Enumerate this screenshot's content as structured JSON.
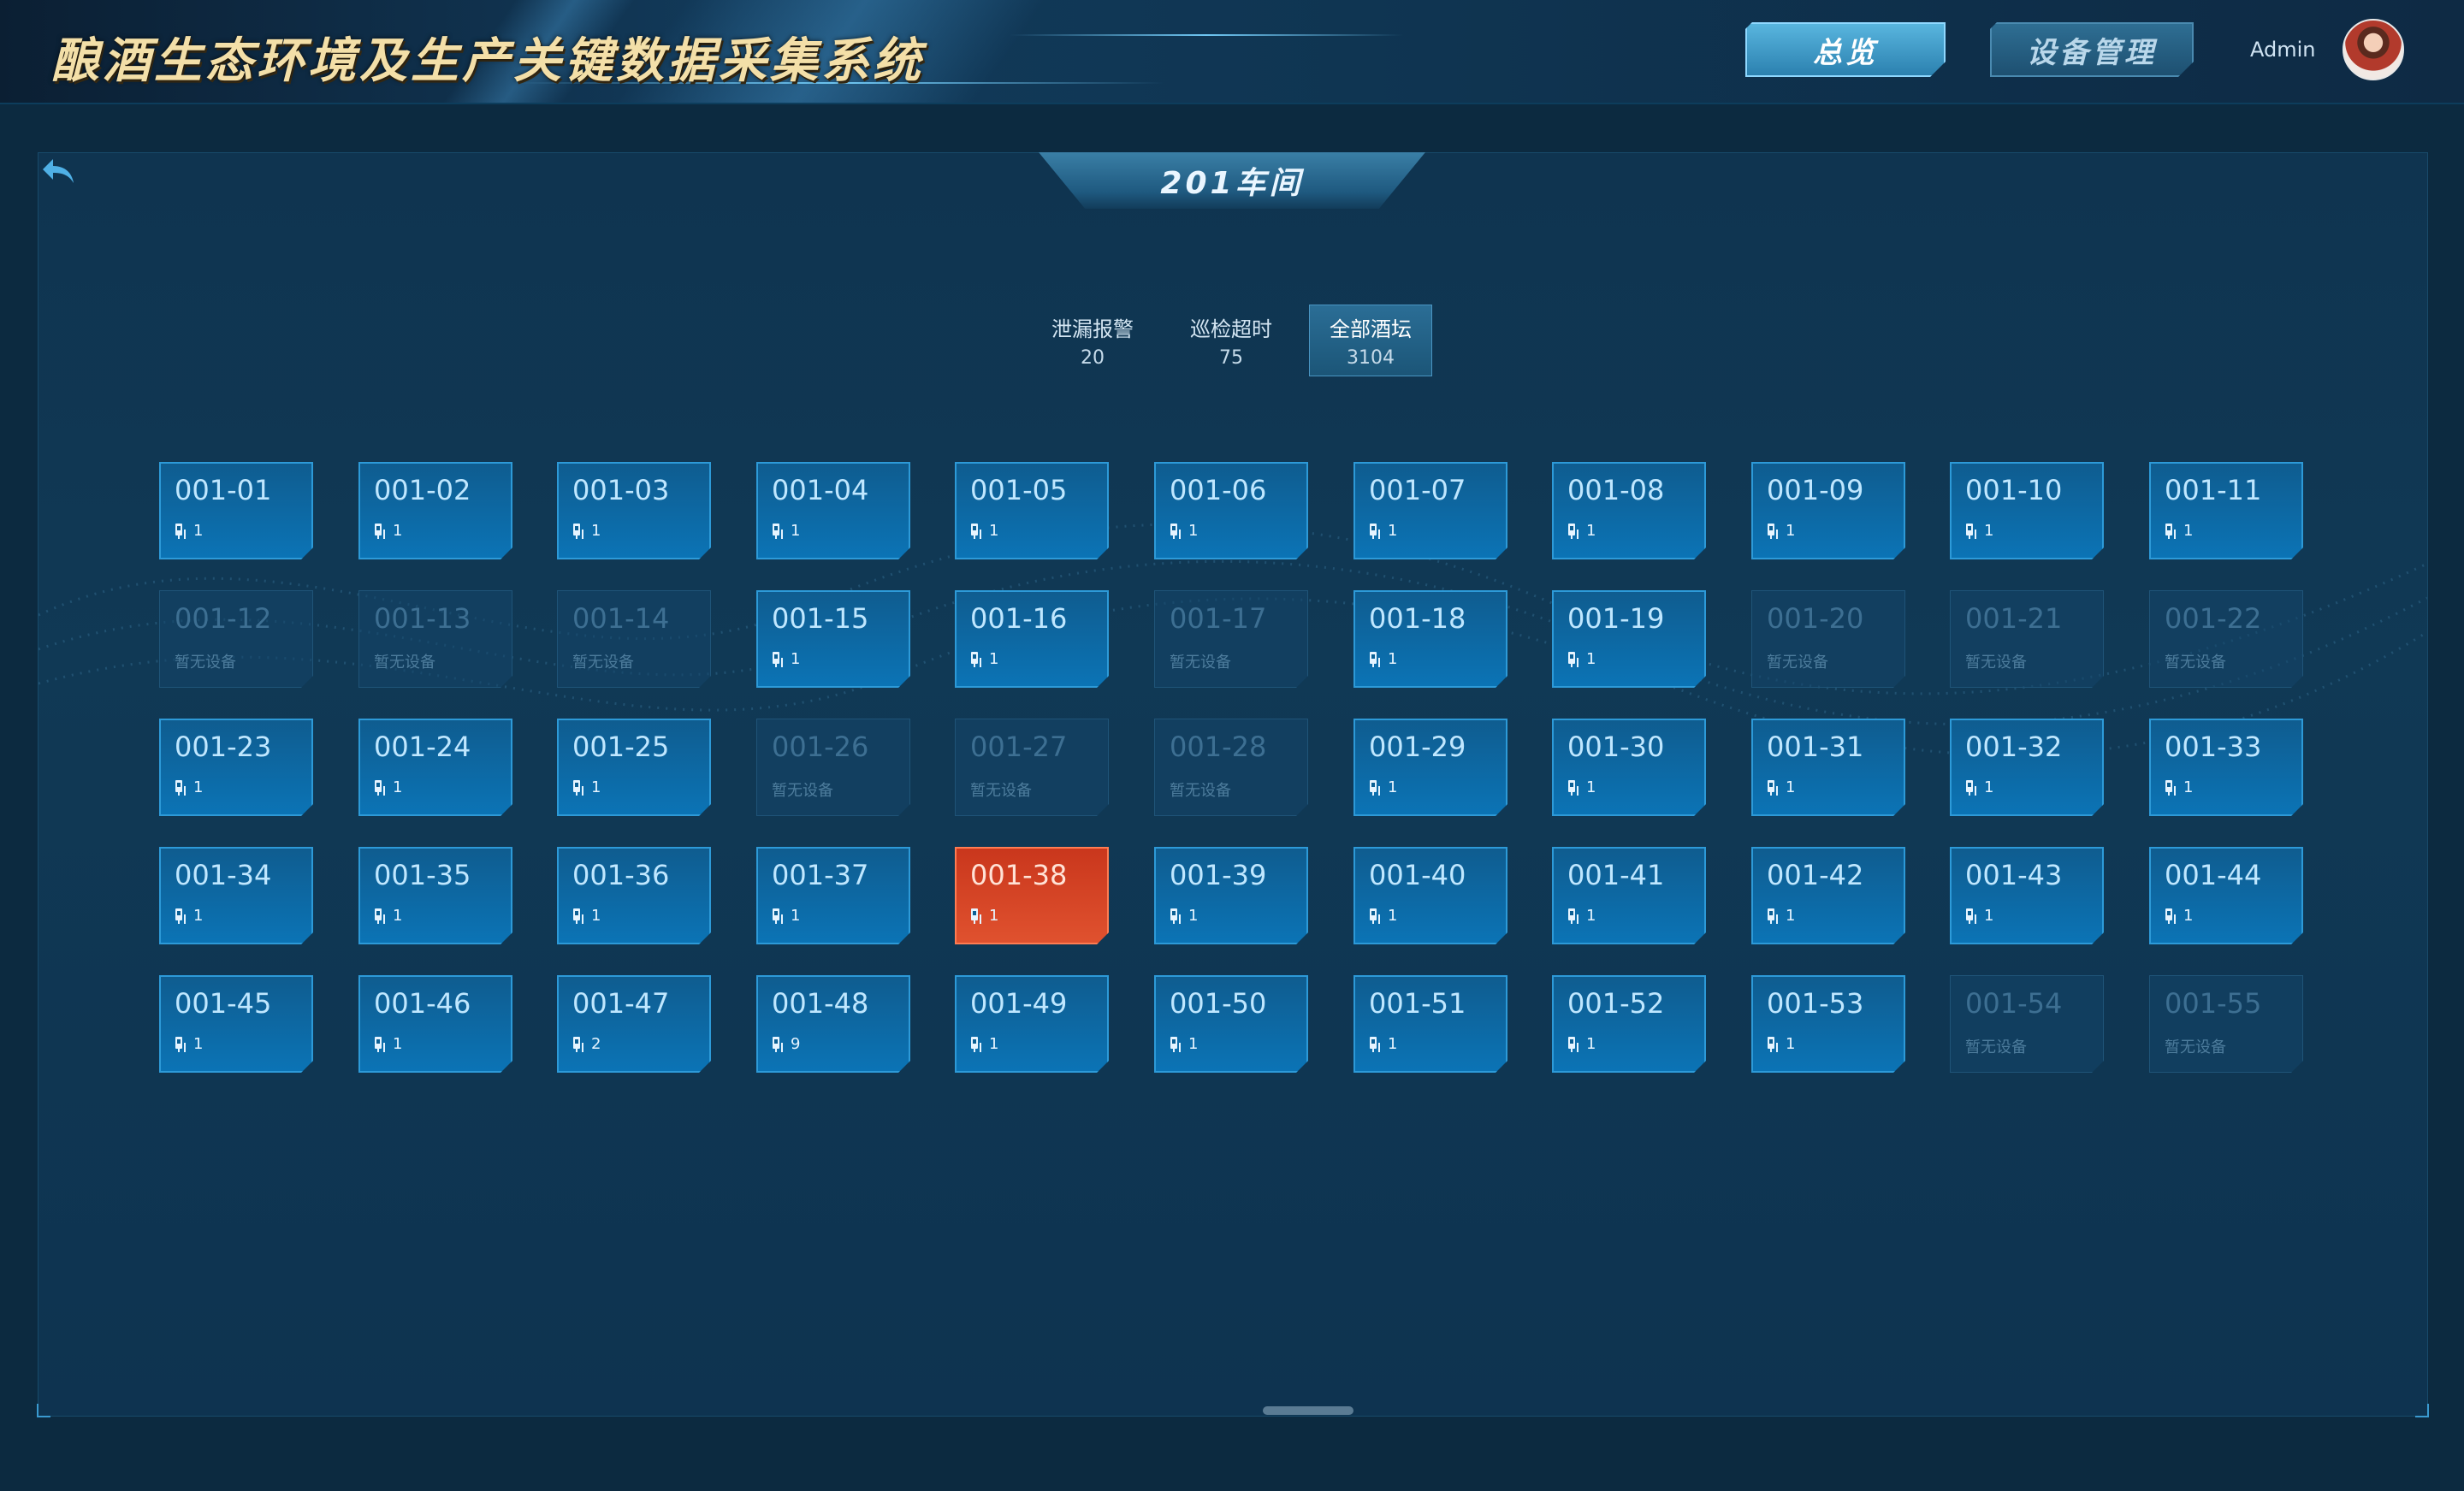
{
  "header": {
    "app_title": "酿酒生态环境及生产关键数据采集系统",
    "nav": {
      "overview": "总览",
      "device_management": "设备管理"
    },
    "user": "Admin"
  },
  "workshop": {
    "title": "201车间"
  },
  "filters": [
    {
      "label": "泄漏报警",
      "count": "20",
      "active": false
    },
    {
      "label": "巡检超时",
      "count": "75",
      "active": false
    },
    {
      "label": "全部酒坛",
      "count": "3104",
      "active": true
    }
  ],
  "no_device_text": "暂无设备",
  "tiles": [
    {
      "code": "001-01",
      "status": "active",
      "devices": "1"
    },
    {
      "code": "001-02",
      "status": "active",
      "devices": "1"
    },
    {
      "code": "001-03",
      "status": "active",
      "devices": "1"
    },
    {
      "code": "001-04",
      "status": "active",
      "devices": "1"
    },
    {
      "code": "001-05",
      "status": "active",
      "devices": "1"
    },
    {
      "code": "001-06",
      "status": "active",
      "devices": "1"
    },
    {
      "code": "001-07",
      "status": "active",
      "devices": "1"
    },
    {
      "code": "001-08",
      "status": "active",
      "devices": "1"
    },
    {
      "code": "001-09",
      "status": "active",
      "devices": "1"
    },
    {
      "code": "001-10",
      "status": "active",
      "devices": "1"
    },
    {
      "code": "001-11",
      "status": "active",
      "devices": "1"
    },
    {
      "code": "001-12",
      "status": "empty",
      "devices": ""
    },
    {
      "code": "001-13",
      "status": "empty",
      "devices": ""
    },
    {
      "code": "001-14",
      "status": "empty",
      "devices": ""
    },
    {
      "code": "001-15",
      "status": "active",
      "devices": "1"
    },
    {
      "code": "001-16",
      "status": "active",
      "devices": "1"
    },
    {
      "code": "001-17",
      "status": "empty",
      "devices": ""
    },
    {
      "code": "001-18",
      "status": "active",
      "devices": "1"
    },
    {
      "code": "001-19",
      "status": "active",
      "devices": "1"
    },
    {
      "code": "001-20",
      "status": "empty",
      "devices": ""
    },
    {
      "code": "001-21",
      "status": "empty",
      "devices": ""
    },
    {
      "code": "001-22",
      "status": "empty",
      "devices": ""
    },
    {
      "code": "001-23",
      "status": "active",
      "devices": "1"
    },
    {
      "code": "001-24",
      "status": "active",
      "devices": "1"
    },
    {
      "code": "001-25",
      "status": "active",
      "devices": "1"
    },
    {
      "code": "001-26",
      "status": "empty",
      "devices": ""
    },
    {
      "code": "001-27",
      "status": "empty",
      "devices": ""
    },
    {
      "code": "001-28",
      "status": "empty",
      "devices": ""
    },
    {
      "code": "001-29",
      "status": "active",
      "devices": "1"
    },
    {
      "code": "001-30",
      "status": "active",
      "devices": "1"
    },
    {
      "code": "001-31",
      "status": "active",
      "devices": "1"
    },
    {
      "code": "001-32",
      "status": "active",
      "devices": "1"
    },
    {
      "code": "001-33",
      "status": "active",
      "devices": "1"
    },
    {
      "code": "001-34",
      "status": "active",
      "devices": "1"
    },
    {
      "code": "001-35",
      "status": "active",
      "devices": "1"
    },
    {
      "code": "001-36",
      "status": "active",
      "devices": "1"
    },
    {
      "code": "001-37",
      "status": "active",
      "devices": "1"
    },
    {
      "code": "001-38",
      "status": "alarm",
      "devices": "1"
    },
    {
      "code": "001-39",
      "status": "active",
      "devices": "1"
    },
    {
      "code": "001-40",
      "status": "active",
      "devices": "1"
    },
    {
      "code": "001-41",
      "status": "active",
      "devices": "1"
    },
    {
      "code": "001-42",
      "status": "active",
      "devices": "1"
    },
    {
      "code": "001-43",
      "status": "active",
      "devices": "1"
    },
    {
      "code": "001-44",
      "status": "active",
      "devices": "1"
    },
    {
      "code": "001-45",
      "status": "active",
      "devices": "1"
    },
    {
      "code": "001-46",
      "status": "active",
      "devices": "1"
    },
    {
      "code": "001-47",
      "status": "active",
      "devices": "2"
    },
    {
      "code": "001-48",
      "status": "active",
      "devices": "9"
    },
    {
      "code": "001-49",
      "status": "active",
      "devices": "1"
    },
    {
      "code": "001-50",
      "status": "active",
      "devices": "1"
    },
    {
      "code": "001-51",
      "status": "active",
      "devices": "1"
    },
    {
      "code": "001-52",
      "status": "active",
      "devices": "1"
    },
    {
      "code": "001-53",
      "status": "active",
      "devices": "1"
    },
    {
      "code": "001-54",
      "status": "empty",
      "devices": ""
    },
    {
      "code": "001-55",
      "status": "empty",
      "devices": ""
    }
  ],
  "colors": {
    "active_tile": "#0b74b6",
    "alarm_tile": "#e0522f",
    "empty_tile": "#1a4d70",
    "accent": "#3a9ad0"
  },
  "icons": {
    "back": "back-arrow-icon",
    "device": "sensor-device-icon"
  }
}
